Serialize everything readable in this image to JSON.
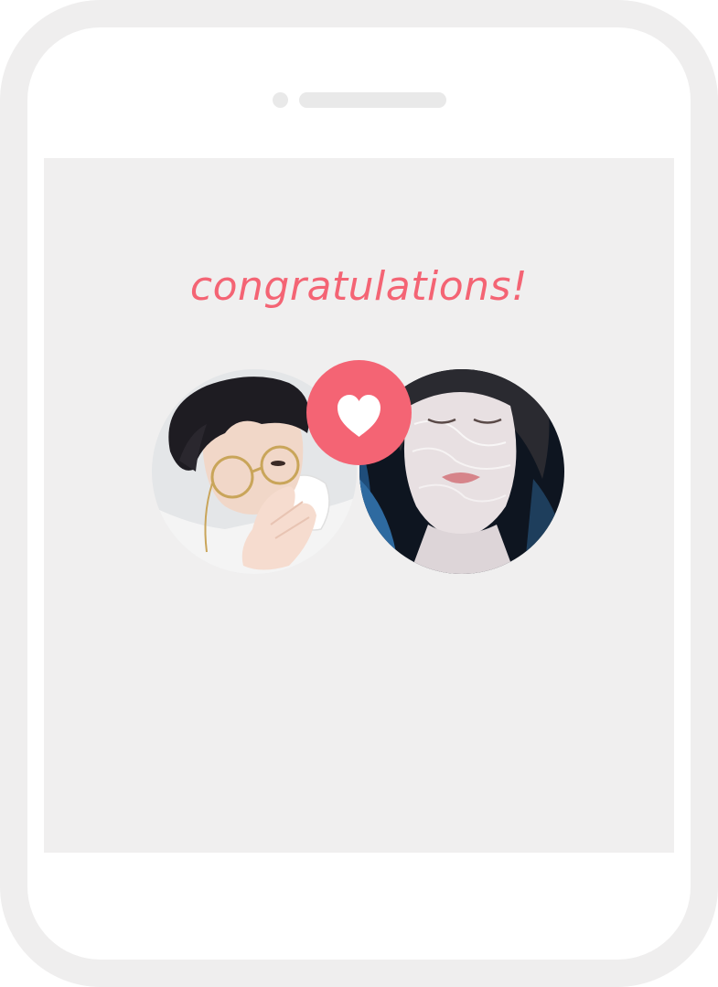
{
  "screen": {
    "title": "congratulations!"
  },
  "match": {
    "left_avatar_icon": "user-photo",
    "right_avatar_icon": "user-photo",
    "badge_icon": "heart-icon"
  },
  "colors": {
    "accent": "#f46474",
    "frame": "#efeeee",
    "screen_bg": "#f0efef",
    "heart_fill": "#ffffff"
  }
}
